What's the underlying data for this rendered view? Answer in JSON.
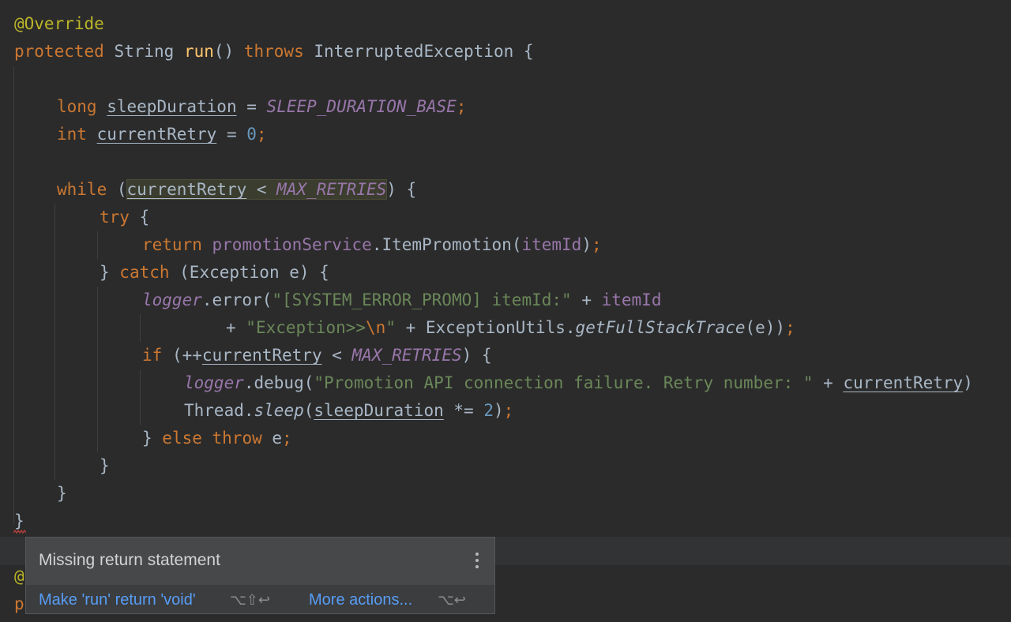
{
  "code": {
    "l1_annotation": "@Override",
    "l2_protected": "protected",
    "l2_type": "String",
    "l2_method": "run",
    "l2_parens": "()",
    "l2_throws": "throws",
    "l2_exception": "InterruptedException {",
    "l3_long": "long",
    "l3_var": "sleepDuration",
    "l3_eq": " = ",
    "l3_const": "SLEEP_DURATION_BASE",
    "semicolon": ";",
    "l4_int": "int",
    "l4_var": "currentRetry",
    "l4_eq": " = ",
    "l4_num": "0",
    "l5_while": "while",
    "l5_open": " (",
    "l5_var": "currentRetry",
    "l5_lt": " < ",
    "l5_const": "MAX_RETRIES",
    "l5_close": ") {",
    "l6_try": "try",
    "l6_brace": " {",
    "l7_return": "return",
    "l7_service": "promotionService",
    "l7_call": ".ItemPromotion(",
    "l7_arg": "itemId",
    "l7_close": ")",
    "l8_close": "} ",
    "l8_catch": "catch",
    "l8_rest": " (Exception e) {",
    "l9_logger": "logger",
    "l9_call": ".error(",
    "l9_str": "\"[SYSTEM_ERROR_PROMO] itemId:\"",
    "l9_plus": " + ",
    "l9_field": "itemId",
    "l10_plus": "+ ",
    "l10_str1": "\"Exception>>",
    "l10_esc": "\\n",
    "l10_str2": "\"",
    "l10_plus2": " + ExceptionUtils.",
    "l10_method": "getFullStackTrace",
    "l10_close": "(e))",
    "l11_if": "if",
    "l11_open": " (++",
    "l11_var": "currentRetry",
    "l11_lt": " < ",
    "l11_const": "MAX_RETRIES",
    "l11_close": ") {",
    "l12_logger": "logger",
    "l12_call": ".debug(",
    "l12_str": "\"Promotion API connection failure. Retry number: \"",
    "l12_plus": " + ",
    "l12_var": "currentRetry",
    "l12_close": ")",
    "l13_thread": "Thread.",
    "l13_sleep": "sleep",
    "l13_open": "(",
    "l13_var": "sleepDuration",
    "l13_op": " *= ",
    "l13_num": "2",
    "l13_close": ")",
    "l14_close": "} ",
    "l14_else": "else throw",
    "l14_e": " e",
    "brace": "}",
    "peek_at": "@",
    "peek_p": "p"
  },
  "popup": {
    "title": "Missing return statement",
    "action1": "Make 'run' return 'void'",
    "shortcut1": "⌥⇧↩",
    "action2": "More actions...",
    "shortcut2": "⌥↩"
  },
  "colors": {
    "background": "#2b2b2b",
    "keyword": "#cc7832",
    "annotation": "#bbb529",
    "method": "#ffc66d",
    "constant": "#9876aa",
    "string": "#6a8759",
    "number": "#6897bb",
    "link": "#589df6",
    "error": "#bc3f3c"
  }
}
